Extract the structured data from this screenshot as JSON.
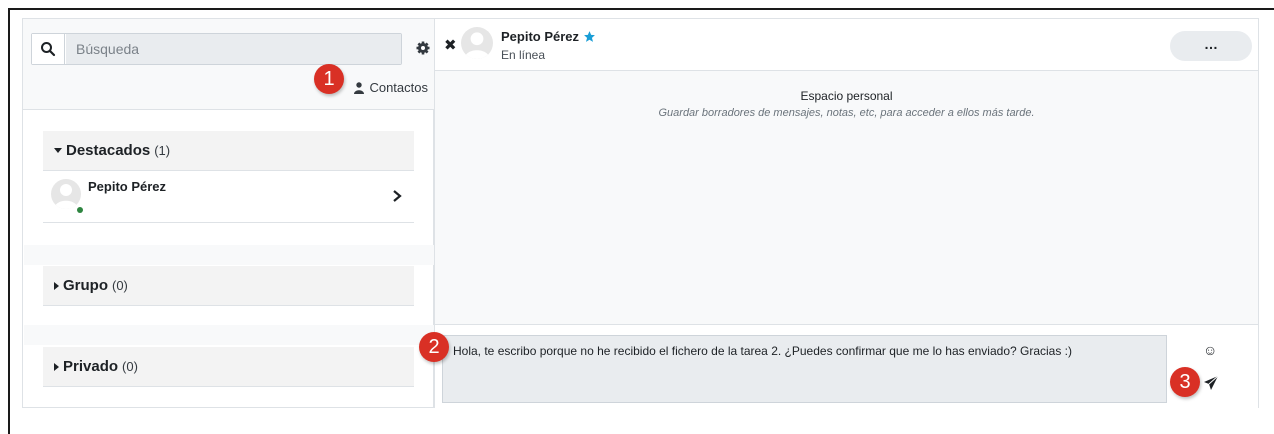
{
  "search": {
    "placeholder": "Búsqueda"
  },
  "contacts_link": "Contactos",
  "sections": [
    {
      "title": "Destacados",
      "count": "(1)",
      "expanded": true
    },
    {
      "title": "Grupo",
      "count": "(0)",
      "expanded": false
    },
    {
      "title": "Privado",
      "count": "(0)",
      "expanded": false
    }
  ],
  "starred_contacts": [
    {
      "name": "Pepito Pérez",
      "status": "online"
    }
  ],
  "conversation": {
    "peer_name": "Pepito Pérez",
    "peer_status": "En línea",
    "more_label": "…"
  },
  "self_space": {
    "title": "Espacio personal",
    "subtitle": "Guardar borradores de mensajes, notas, etc, para acceder a ellos más tarde."
  },
  "composer": {
    "message": "Hola, te escribo porque no he recibido el fichero de la tarea 2. ¿Puedes confirmar que me lo has enviado? Gracias :)"
  },
  "markers": [
    "1",
    "2",
    "3"
  ],
  "colors": {
    "marker": "#d93025",
    "star": "#1a9ed6",
    "online": "#2e8540"
  }
}
